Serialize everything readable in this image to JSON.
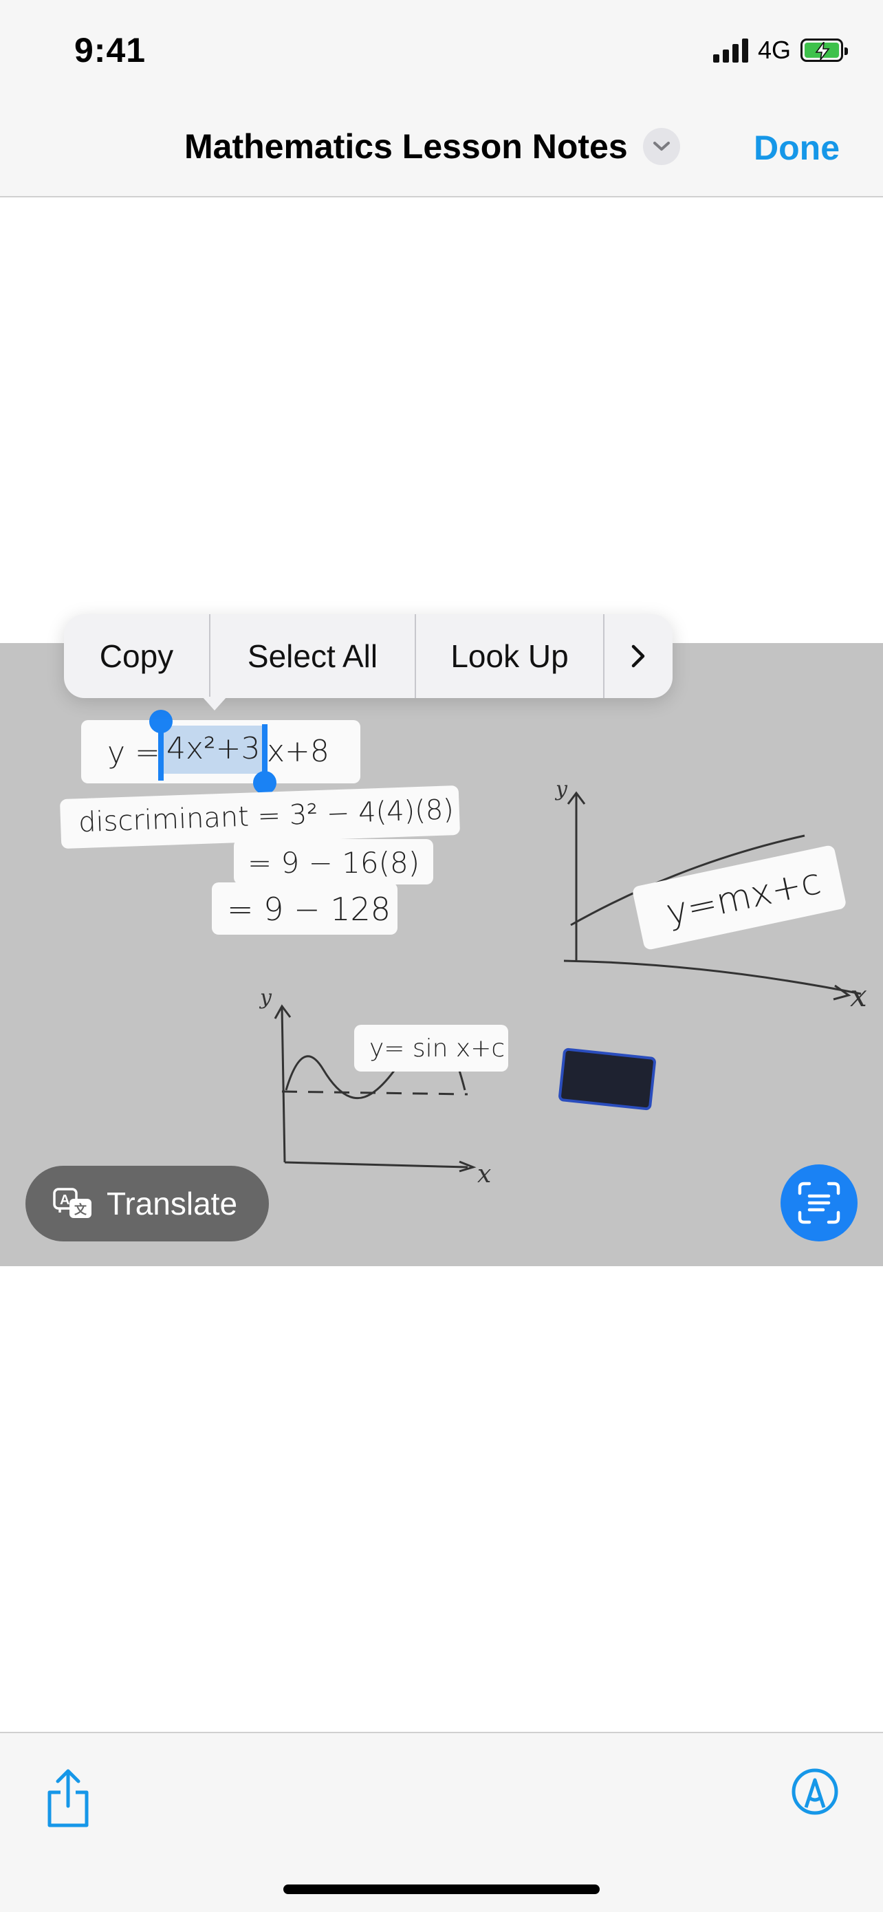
{
  "status_bar": {
    "time": "9:41",
    "network": "4G"
  },
  "nav": {
    "title": "Mathematics Lesson Notes",
    "done_label": "Done"
  },
  "photo": {
    "eq_prefix": "y =",
    "eq_selected": "4x²+3",
    "eq_rest": "x+8",
    "disc_line1": "discriminant = 3² − 4(4)(8)",
    "disc_line2": "= 9 − 16(8)",
    "disc_line3": "= 9 − 128",
    "linear_label": "y=mx+c",
    "sine_label": "y= sin x+c",
    "axis_y": "y",
    "axis_x": "x"
  },
  "context_menu": {
    "copy": "Copy",
    "select_all": "Select All",
    "look_up": "Look Up",
    "more": "›"
  },
  "translate_label": "Translate",
  "colors": {
    "accent": "#1697e8",
    "selection": "#1a82f4",
    "photo_bg": "#c3c3c3"
  }
}
